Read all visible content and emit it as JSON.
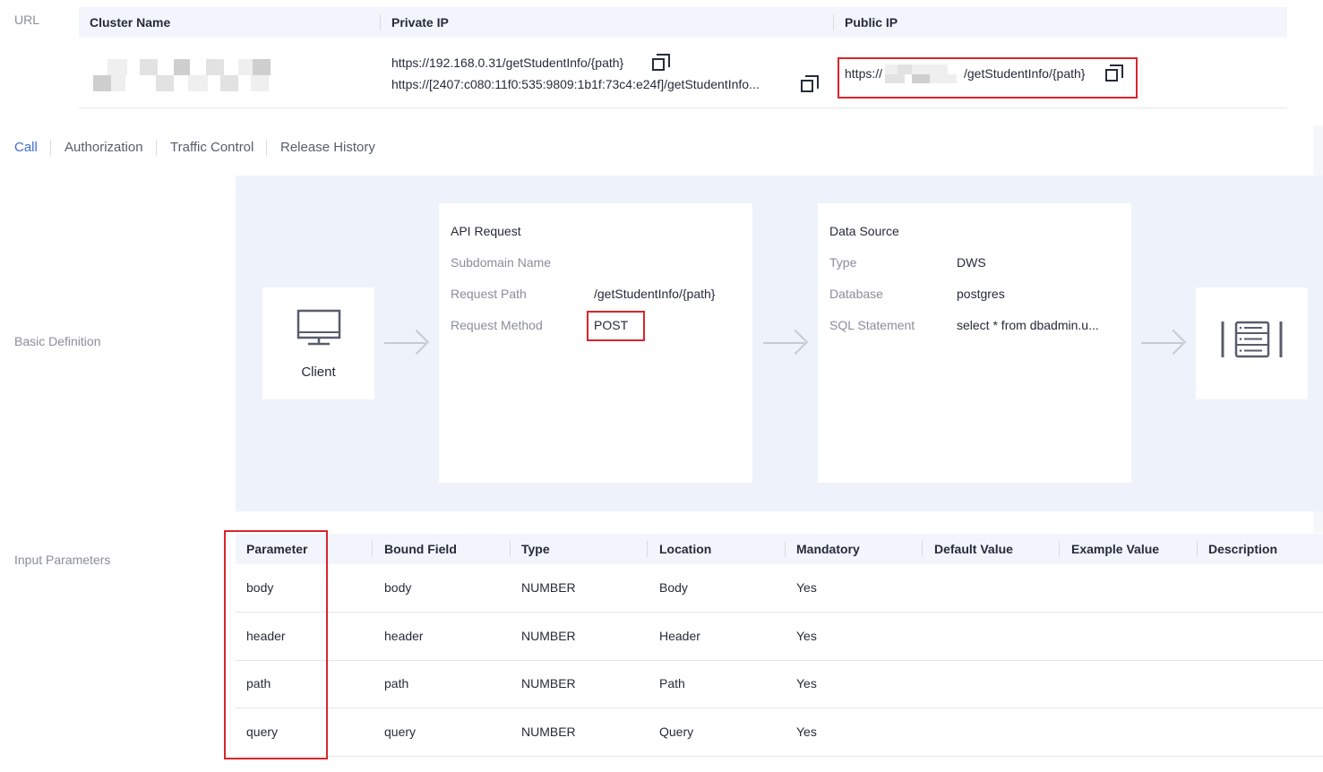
{
  "url_section": {
    "label": "URL",
    "headers": [
      "Cluster Name",
      "Private IP",
      "Public IP"
    ],
    "private_ips": [
      "https://192.168.0.31/getStudentInfo/{path}",
      "https://[2407:c080:11f0:535:9809:1b1f:73c4:e24f]/getStudentInfo..."
    ],
    "public_ip_prefix": "https://",
    "public_ip_suffix": "/getStudentInfo/{path}"
  },
  "tabs": [
    "Call",
    "Authorization",
    "Traffic Control",
    "Release History"
  ],
  "active_tab": "Call",
  "basic_definition": {
    "label": "Basic Definition",
    "client_label": "Client",
    "api_request": {
      "title": "API Request",
      "rows": [
        {
          "key": "Subdomain Name",
          "value": ""
        },
        {
          "key": "Request Path",
          "value": "/getStudentInfo/{path}"
        },
        {
          "key": "Request Method",
          "value": "POST"
        }
      ]
    },
    "data_source": {
      "title": "Data Source",
      "rows": [
        {
          "key": "Type",
          "value": "DWS"
        },
        {
          "key": "Database",
          "value": "postgres"
        },
        {
          "key": "SQL Statement",
          "value": "select * from dbadmin.u..."
        }
      ]
    }
  },
  "input_parameters": {
    "label": "Input Parameters",
    "columns": [
      "Parameter",
      "Bound Field",
      "Type",
      "Location",
      "Mandatory",
      "Default Value",
      "Example Value",
      "Description"
    ],
    "rows": [
      {
        "parameter": "body",
        "bound_field": "body",
        "type": "NUMBER",
        "location": "Body",
        "mandatory": "Yes"
      },
      {
        "parameter": "header",
        "bound_field": "header",
        "type": "NUMBER",
        "location": "Header",
        "mandatory": "Yes"
      },
      {
        "parameter": "path",
        "bound_field": "path",
        "type": "NUMBER",
        "location": "Path",
        "mandatory": "Yes"
      },
      {
        "parameter": "query",
        "bound_field": "query",
        "type": "NUMBER",
        "location": "Query",
        "mandatory": "Yes"
      }
    ]
  },
  "colors": {
    "accent": "#3f6dd4",
    "highlight_red": "#d9252b",
    "diagram_bg": "#eef2fb",
    "table_head_bg": "#f2f5fc"
  },
  "icons": [
    "copy-icon",
    "monitor-icon",
    "arrow-right-icon",
    "server-list-icon"
  ]
}
